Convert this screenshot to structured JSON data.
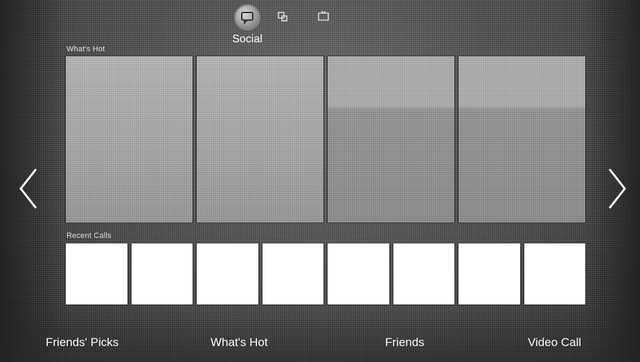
{
  "topbar": {
    "categories": [
      {
        "icon": "social-chat-icon",
        "label": "Social",
        "selected": true
      },
      {
        "icon": "apps-icon"
      },
      {
        "icon": "tv-icon"
      }
    ]
  },
  "sections": {
    "whats_hot_label": "What's Hot",
    "recent_calls_label": "Recent Calls"
  },
  "hot_tiles_count": 4,
  "call_tiles_count": 8,
  "navigation": {
    "left_arrow_icon": "chevron-left-icon",
    "right_arrow_icon": "chevron-right-icon"
  },
  "bottom_nav": [
    {
      "label": "Friends' Picks"
    },
    {
      "label": "What's Hot"
    },
    {
      "label": "Friends"
    },
    {
      "label": "Video Call"
    }
  ]
}
